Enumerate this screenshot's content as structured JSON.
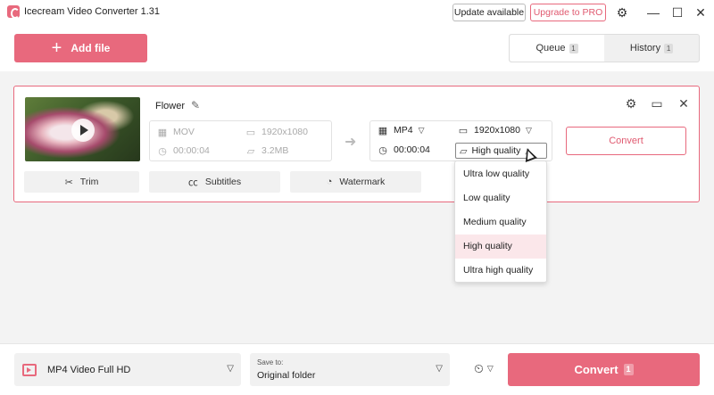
{
  "app": {
    "title": "Icecream Video Converter 1.31",
    "update_label": "Update available",
    "pro_label": "Upgrade to PRO",
    "accent_color": "#e8697d"
  },
  "header": {
    "add_file_label": "Add file",
    "tabs": [
      {
        "label": "Queue",
        "count": "1"
      },
      {
        "label": "History",
        "count": "1"
      }
    ]
  },
  "file": {
    "name": "Flower",
    "source": {
      "format": "MOV",
      "resolution": "1920x1080",
      "duration": "00:00:04",
      "size": "3.2MB"
    },
    "target": {
      "format": "MP4",
      "resolution": "1920x1080",
      "duration": "00:00:04",
      "quality": "High quality"
    },
    "convert_label": "Convert",
    "actions": [
      {
        "label": "Trim",
        "icon": "scissors-icon"
      },
      {
        "label": "Subtitles",
        "icon": "cc-icon"
      },
      {
        "label": "Watermark",
        "icon": "watermark-icon"
      }
    ]
  },
  "quality_dropdown": {
    "options": [
      "Ultra low quality",
      "Low quality",
      "Medium quality",
      "High quality",
      "Ultra high quality"
    ],
    "highlighted": "High quality"
  },
  "footer": {
    "preset": "MP4 Video Full HD",
    "save_to_label": "Save to:",
    "save_to_value": "Original folder",
    "convert_label": "Convert",
    "convert_count": "1"
  }
}
